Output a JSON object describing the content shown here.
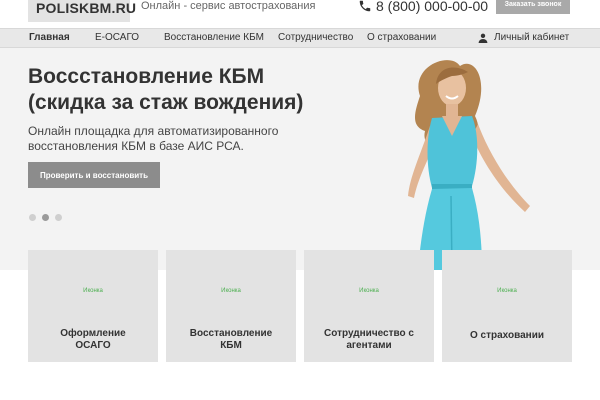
{
  "header": {
    "logo": "POLISKBM.RU",
    "slogan": "Онлайн - сервис автострахования",
    "phone_icon": "phone-icon",
    "phone": "8 (800) 000-00-00",
    "callback_label": "Заказать звонок"
  },
  "nav": {
    "items": [
      {
        "label": "Главная",
        "active": true
      },
      {
        "label": "Е-ОСАГО",
        "active": false
      },
      {
        "label": "Восстановление КБМ",
        "active": false
      },
      {
        "label": "Сотрудничество",
        "active": false
      },
      {
        "label": "О страховании",
        "active": false
      }
    ],
    "cabinet_icon": "user-icon",
    "cabinet_label": "Личный кабинет"
  },
  "hero": {
    "title_line1": "Воссстановление КБМ",
    "title_line2": "(скидка за стаж вождения)",
    "subtitle_line1": "Онлайн площадка для автоматизированного",
    "subtitle_line2": "восстановления КБМ в базе АИС РСА.",
    "button_label": "Проверить и восстановить",
    "slides": 3,
    "active_slide": 2
  },
  "cards": [
    {
      "icon_text": "Иконка",
      "label_line1": "Оформление",
      "label_line2": "ОСАГО"
    },
    {
      "icon_text": "Иконка",
      "label_line1": "Восстановление",
      "label_line2": "КБМ"
    },
    {
      "icon_text": "Иконка",
      "label_line1": "Сотрудничество с",
      "label_line2": "агентами"
    },
    {
      "icon_text": "Иконка",
      "label_line1": "О страховании",
      "label_line2": ""
    }
  ],
  "colors": {
    "accent_green": "#4caf50",
    "dress": "#4fc3d9",
    "button_gray": "#8c8c8c"
  }
}
